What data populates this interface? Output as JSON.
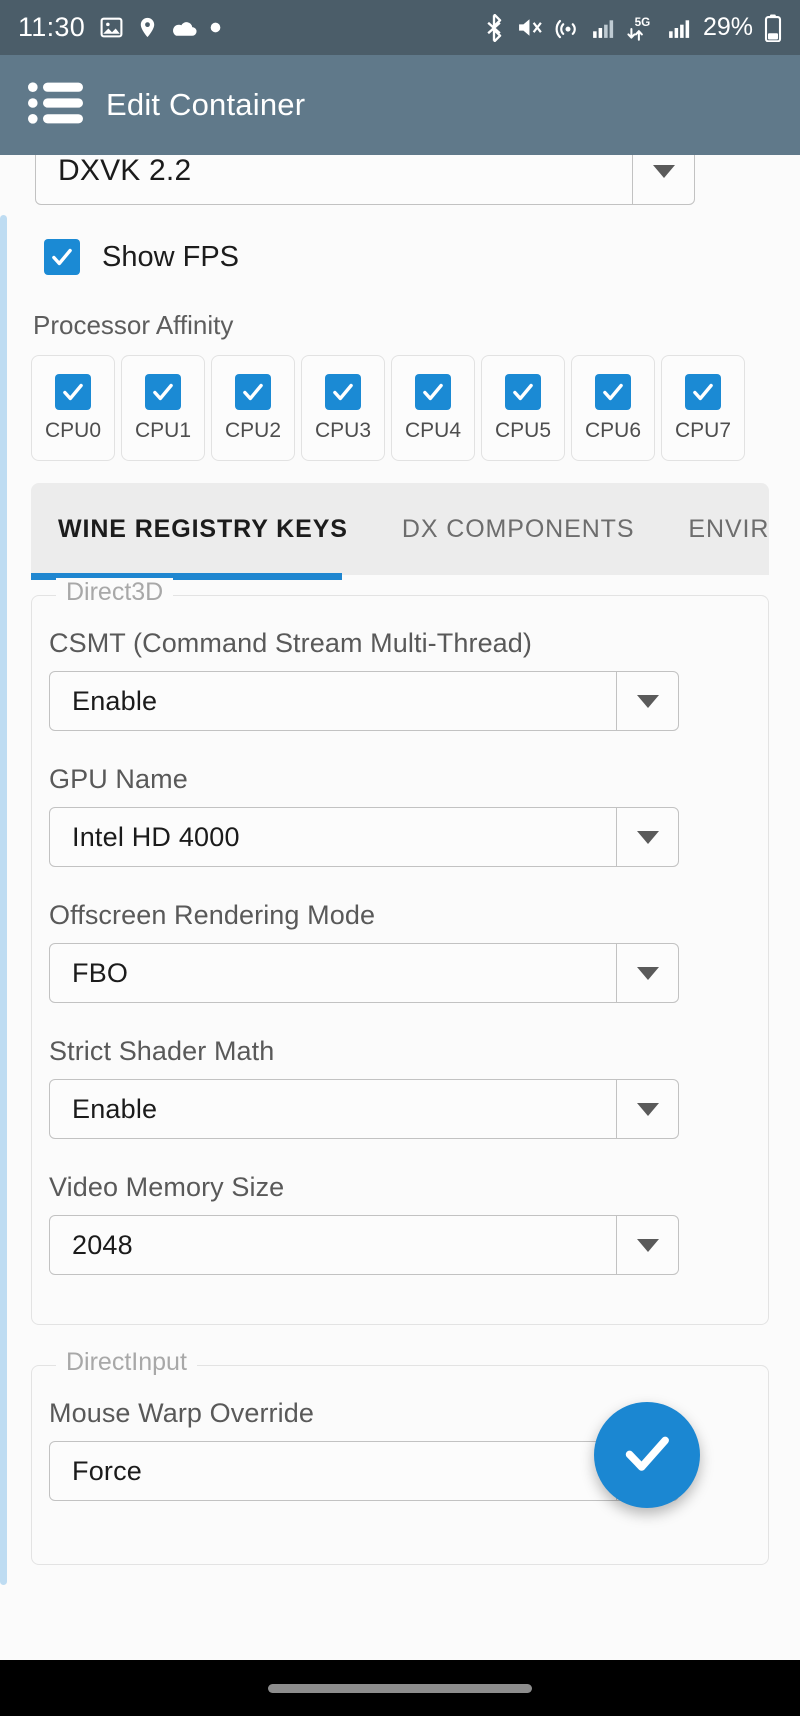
{
  "status_bar": {
    "time": "11:30",
    "battery_percent": "29%",
    "left_icons": [
      "screenshot-image-icon",
      "location-pin-icon",
      "cloud-icon",
      "dot-icon"
    ],
    "right_icons": [
      "bluetooth-icon",
      "mute-icon",
      "hotspot-icon",
      "signal-bars-icon",
      "5g-data-icon",
      "signal-bars-2-icon",
      "battery-icon"
    ],
    "network_label": "5G",
    "background": "#4b5d69"
  },
  "app_bar": {
    "title": "Edit Container",
    "menu_icon": "list-menu-icon",
    "background": "#60798a"
  },
  "top_partial": {
    "dxvk_value": "DXVK 2.2"
  },
  "show_fps": {
    "label": "Show FPS",
    "checked": true
  },
  "processor_affinity": {
    "title": "Processor Affinity",
    "cpus": [
      {
        "label": "CPU0",
        "checked": true
      },
      {
        "label": "CPU1",
        "checked": true
      },
      {
        "label": "CPU2",
        "checked": true
      },
      {
        "label": "CPU3",
        "checked": true
      },
      {
        "label": "CPU4",
        "checked": true
      },
      {
        "label": "CPU5",
        "checked": true
      },
      {
        "label": "CPU6",
        "checked": true
      },
      {
        "label": "CPU7",
        "checked": true
      }
    ]
  },
  "tabs": {
    "items": [
      {
        "label": "WINE REGISTRY KEYS",
        "active": true
      },
      {
        "label": "DX COMPONENTS",
        "active": false
      },
      {
        "label": "ENVIR",
        "active": false
      }
    ],
    "accent_color": "#1f86d0"
  },
  "groups": [
    {
      "label": "Direct3D",
      "fields": [
        {
          "label": "CSMT (Command Stream Multi-Thread)",
          "value": "Enable"
        },
        {
          "label": "GPU Name",
          "value": "Intel HD 4000"
        },
        {
          "label": "Offscreen Rendering Mode",
          "value": "FBO"
        },
        {
          "label": "Strict Shader Math",
          "value": "Enable"
        },
        {
          "label": "Video Memory Size",
          "value": "2048"
        }
      ]
    },
    {
      "label": "DirectInput",
      "fields": [
        {
          "label": "Mouse Warp Override",
          "value": "Force"
        }
      ]
    }
  ],
  "fab": {
    "icon": "check-icon",
    "color": "#1b87d2"
  },
  "nav_bar": {
    "gesture_pill": "gesture-pill"
  }
}
